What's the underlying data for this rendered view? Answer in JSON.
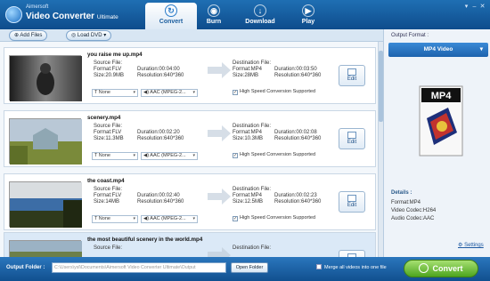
{
  "app": {
    "brand_small": "Aimersoft",
    "brand_main": "Video Converter",
    "brand_edition": "Ultimate"
  },
  "tabs": [
    {
      "label": "Convert",
      "active": true
    },
    {
      "label": "Burn",
      "active": false
    },
    {
      "label": "Download",
      "active": false
    },
    {
      "label": "Play",
      "active": false
    }
  ],
  "toolbar": {
    "add_files": "Add Files",
    "load_dvd": "Load DVD"
  },
  "common": {
    "source_file": "Source File:",
    "destination_file": "Destination File:",
    "edit": "Edit",
    "subtitle_value": "None",
    "high_speed": "High Speed Conversion Supported"
  },
  "files": [
    {
      "name": "you raise me up.mp4",
      "src": {
        "format": "Format:FLV",
        "duration": "Duration:00:04:00",
        "size": "Size:20.9MB",
        "resolution": "Resolution:640*360"
      },
      "dst": {
        "format": "Format:MP4",
        "duration": "Duration:00:03:50",
        "size": "Size:28MB",
        "resolution": "Resolution:640*360"
      },
      "audio": "AAC (MPEG-2..."
    },
    {
      "name": "scenery.mp4",
      "src": {
        "format": "Format:FLV",
        "duration": "Duration:00:02:20",
        "size": "Size:11.3MB",
        "resolution": "Resolution:640*360"
      },
      "dst": {
        "format": "Format:MP4",
        "duration": "Duration:00:02:08",
        "size": "Size:10.3MB",
        "resolution": "Resolution:640*360"
      },
      "audio": "AAC (MPEG-2..."
    },
    {
      "name": "the coast.mp4",
      "src": {
        "format": "Format:FLV",
        "duration": "Duration:00:02:40",
        "size": "Size:14MB",
        "resolution": "Resolution:640*360"
      },
      "dst": {
        "format": "Format:MP4",
        "duration": "Duration:00:02:23",
        "size": "Size:12.5MB",
        "resolution": "Resolution:640*360"
      },
      "audio": "AAC (MPEG-2..."
    },
    {
      "name": "the most beautiful scenery in the world.mp4",
      "src": {
        "format": "",
        "duration": "",
        "size": "",
        "resolution": ""
      },
      "dst": {
        "format": "",
        "duration": "",
        "size": "",
        "resolution": ""
      },
      "audio": ""
    }
  ],
  "right_panel": {
    "output_format_label": "Output Format :",
    "format_selected": "MP4 Video",
    "format_icon_text": "MP4",
    "details_title": "Details :",
    "details": [
      "Format:MP4",
      "Video Codec:H264",
      "Audio Codec:AAC"
    ],
    "settings": "Settings"
  },
  "bottom": {
    "output_folder_label": "Output Folder :",
    "output_path": "C:\\Users\\ysl\\Documents\\Aimersoft Video Converter Ultimate\\Output",
    "open_folder": "Open Folder",
    "merge_label": "Merge all videos into one file",
    "convert": "Convert"
  }
}
